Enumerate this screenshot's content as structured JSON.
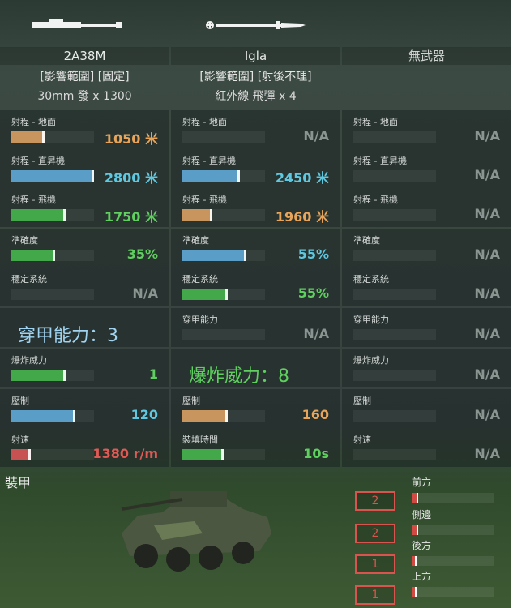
{
  "colors": {
    "orange": "#e8a55a",
    "blue": "#5fc8e0",
    "green": "#5fd05f",
    "red": "#e05a55",
    "grey": "#8a9491",
    "bar_blue": "#5a9ec8",
    "bar_green": "#43a84a",
    "bar_orange": "#c8955f",
    "bar_red": "#c85252",
    "armor_red": "#d9544e"
  },
  "weapons": [
    {
      "name": "2A38M",
      "tags": "[影響範圍] [固定]",
      "ammo": "30mm 發 x 1300",
      "image_icon": "cannon-icon"
    },
    {
      "name": "Igla",
      "tags": "[影響範圍] [射後不理]",
      "ammo": "紅外線 飛彈 x 4",
      "image_icon": "missile-icon"
    },
    {
      "name": "無武器",
      "tags": "",
      "ammo": "",
      "image_icon": ""
    }
  ],
  "stats": [
    {
      "cells": [
        {
          "label": "射程 - 地面",
          "value": "1050 米",
          "fill": 0.4,
          "bar": "orange",
          "vcolor": "orange"
        },
        {
          "label": "射程 - 直昇機",
          "value": "2800 米",
          "fill": 1.0,
          "bar": "blue",
          "vcolor": "blue"
        },
        {
          "label": "射程 - 飛機",
          "value": "1750 米",
          "fill": 0.66,
          "bar": "green",
          "vcolor": "green"
        },
        {
          "label": "準確度",
          "value": "35%",
          "fill": 0.53,
          "bar": "green",
          "vcolor": "green"
        },
        {
          "label": "穩定系統",
          "value": "N/A",
          "fill": 0,
          "bar": "",
          "vcolor": "grey"
        },
        {
          "label": "",
          "value": "",
          "fill": 0,
          "bar": "",
          "vcolor": "grey",
          "big": "穿甲能力：3",
          "bigcolor": "#9fd3f0"
        },
        {
          "label": "爆炸威力",
          "value": "1",
          "fill": 0.66,
          "bar": "green",
          "vcolor": "green"
        },
        {
          "label": "壓制",
          "value": "120",
          "fill": 0.77,
          "bar": "blue",
          "vcolor": "blue"
        },
        {
          "label": "射速",
          "value": "1380 r/m",
          "fill": 0.24,
          "bar": "red",
          "vcolor": "red"
        }
      ]
    },
    {
      "cells": [
        {
          "label": "射程 - 地面",
          "value": "N/A",
          "fill": 0,
          "bar": "",
          "vcolor": "grey"
        },
        {
          "label": "射程 - 直昇機",
          "value": "2450 米",
          "fill": 0.7,
          "bar": "blue",
          "vcolor": "blue"
        },
        {
          "label": "射程 - 飛機",
          "value": "1960 米",
          "fill": 0.36,
          "bar": "orange",
          "vcolor": "orange"
        },
        {
          "label": "準確度",
          "value": "55%",
          "fill": 0.77,
          "bar": "blue",
          "vcolor": "blue"
        },
        {
          "label": "穩定系統",
          "value": "55%",
          "fill": 0.55,
          "bar": "green",
          "vcolor": "green"
        },
        {
          "label": "穿甲能力",
          "value": "N/A",
          "fill": 0,
          "bar": "",
          "vcolor": "grey"
        },
        {
          "label": "",
          "value": "",
          "fill": 0,
          "bar": "",
          "vcolor": "grey",
          "big": "爆炸威力：8",
          "bigcolor": "#5fd05f"
        },
        {
          "label": "壓制",
          "value": "160",
          "fill": 0.55,
          "bar": "orange",
          "vcolor": "orange"
        },
        {
          "label": "裝填時間",
          "value": "10s",
          "fill": 0.5,
          "bar": "green",
          "vcolor": "green"
        }
      ]
    },
    {
      "cells": [
        {
          "label": "射程 - 地面",
          "value": "N/A",
          "fill": 0,
          "bar": "",
          "vcolor": "grey"
        },
        {
          "label": "射程 - 直昇機",
          "value": "N/A",
          "fill": 0,
          "bar": "",
          "vcolor": "grey"
        },
        {
          "label": "射程 - 飛機",
          "value": "N/A",
          "fill": 0,
          "bar": "",
          "vcolor": "grey"
        },
        {
          "label": "準確度",
          "value": "N/A",
          "fill": 0,
          "bar": "",
          "vcolor": "grey"
        },
        {
          "label": "穩定系統",
          "value": "N/A",
          "fill": 0,
          "bar": "",
          "vcolor": "grey"
        },
        {
          "label": "穿甲能力",
          "value": "N/A",
          "fill": 0,
          "bar": "",
          "vcolor": "grey"
        },
        {
          "label": "爆炸威力",
          "value": "N/A",
          "fill": 0,
          "bar": "",
          "vcolor": "grey"
        },
        {
          "label": "壓制",
          "value": "N/A",
          "fill": 0,
          "bar": "",
          "vcolor": "grey"
        },
        {
          "label": "射速",
          "value": "N/A",
          "fill": 0,
          "bar": "",
          "vcolor": "grey"
        }
      ]
    }
  ],
  "armor": {
    "title": "裝甲",
    "vehicle_icon": "armored-vehicle-icon",
    "rows": [
      {
        "label": "前方",
        "value": "2",
        "fill": 0.08
      },
      {
        "label": "側邊",
        "value": "2",
        "fill": 0.08
      },
      {
        "label": "後方",
        "value": "1",
        "fill": 0.06
      },
      {
        "label": "上方",
        "value": "1",
        "fill": 0.06
      }
    ]
  }
}
